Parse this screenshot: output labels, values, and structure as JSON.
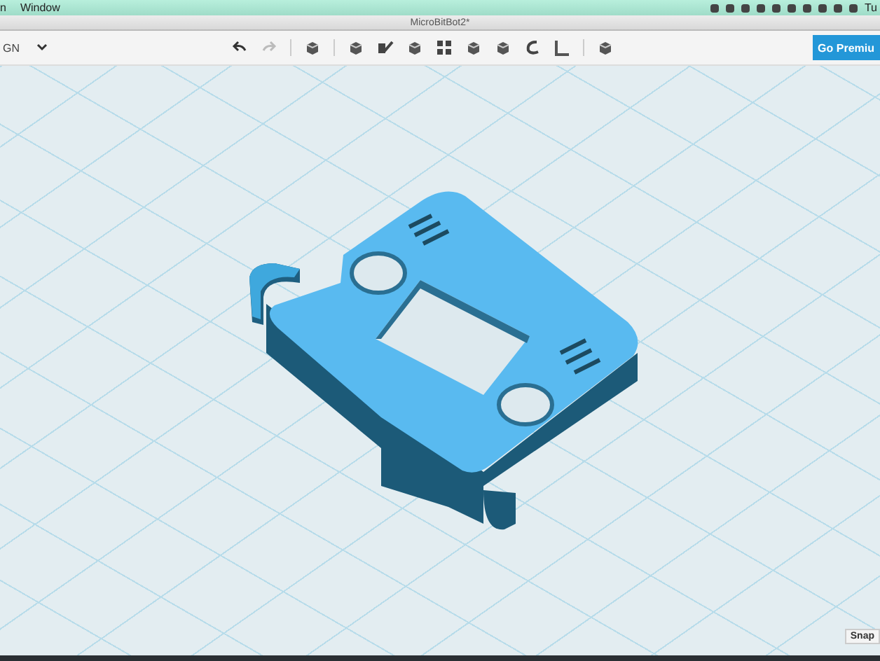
{
  "menu_bar": {
    "items": [
      "n",
      "Window"
    ],
    "clock": "Tu"
  },
  "window": {
    "title": "MicroBitBot2*"
  },
  "toolbar": {
    "workspace": "GN",
    "premium_button": "Go Premiu"
  },
  "canvas": {
    "snap_button": "Snap"
  }
}
